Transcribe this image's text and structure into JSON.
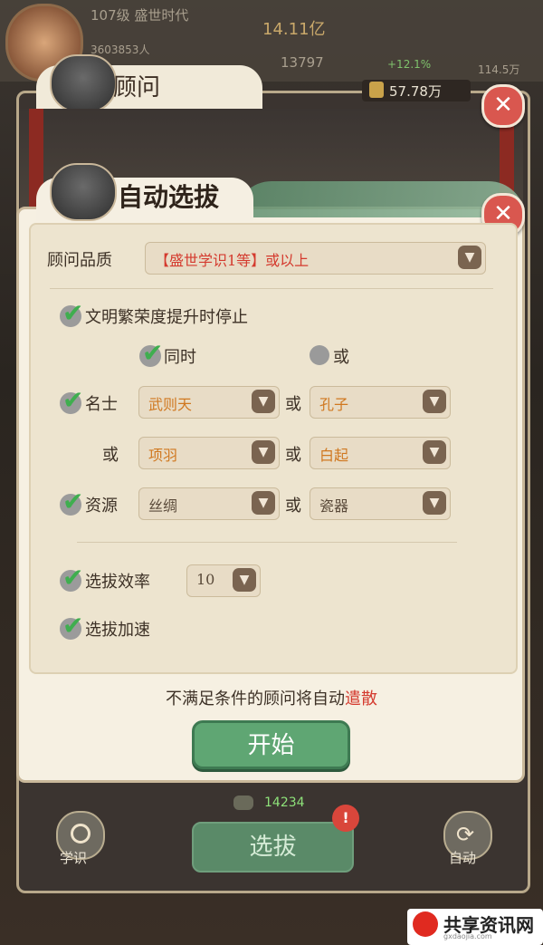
{
  "background": {
    "player_level": "107级 盛世时代",
    "player_sub": "3603853人",
    "currency": "14.11亿",
    "counter_top": "13797",
    "counter_right": "+12.1%",
    "counter_right2": "114.5万",
    "outer_title": "顾问",
    "gold": "57.78万",
    "bottom_counter": "14234",
    "left_button_label": "学识",
    "right_button_label": "自动",
    "bottom_select_label": "选拔"
  },
  "dialog": {
    "title": "自动选拔",
    "quality": {
      "label": "顾问品质",
      "value": "【盛世学识1等】或以上"
    },
    "stop_on_prosperity": {
      "label": "文明繁荣度提升时停止",
      "checked": true
    },
    "mode": {
      "both_label": "同时",
      "either_label": "或",
      "selected": "同时"
    },
    "celebrity": {
      "label": "名士",
      "checked": true,
      "or_label": "或",
      "row1": [
        "武则天",
        "孔子"
      ],
      "row2": [
        "项羽",
        "白起"
      ]
    },
    "resource": {
      "label": "资源",
      "checked": true,
      "or_label": "或",
      "values": [
        "丝绸",
        "瓷器"
      ]
    },
    "efficiency": {
      "label": "选拔效率",
      "checked": true,
      "value": "10"
    },
    "speedup": {
      "label": "选拔加速",
      "checked": true
    },
    "note_prefix": "不满足条件的顾问将自动",
    "note_highlight": "遣散",
    "start_label": "开始"
  },
  "watermark": {
    "text": "共享资讯网",
    "sub": "gxdaojia.com"
  },
  "icons": {
    "check": "check-icon",
    "chevron": "chevron-down-icon",
    "close": "close-icon"
  }
}
